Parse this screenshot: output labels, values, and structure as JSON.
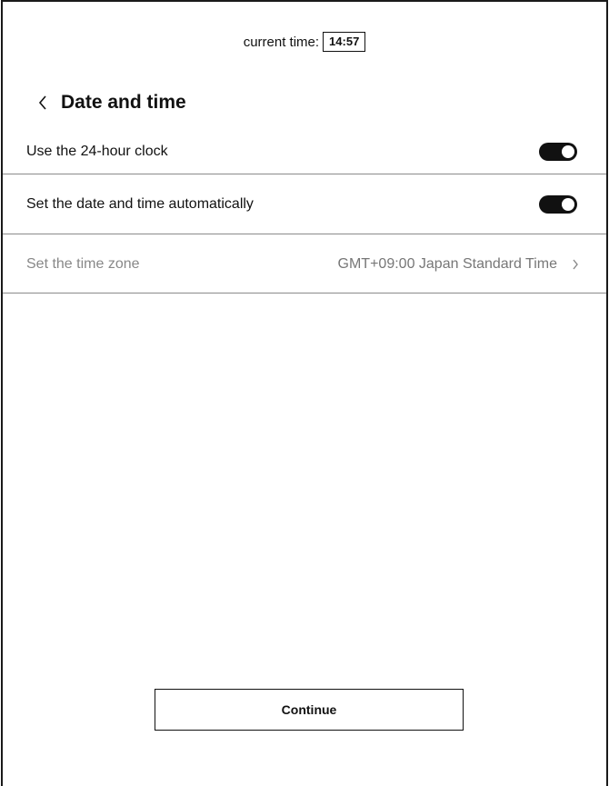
{
  "status_bar": {
    "label": "current time:",
    "time": "14:57"
  },
  "header": {
    "back_icon": "chevron-left-icon",
    "title": "Date and time"
  },
  "settings": {
    "clock_24h": {
      "label": "Use the 24-hour clock",
      "enabled": true
    },
    "auto_datetime": {
      "label": "Set the date and time automatically",
      "enabled": true
    },
    "time_zone": {
      "label": "Set the time zone",
      "value": "GMT+09:00 Japan Standard Time",
      "icon": "chevron-right-icon",
      "disabled": true
    }
  },
  "footer": {
    "continue_label": "Continue"
  },
  "colors": {
    "text": "#111111",
    "muted_text": "#888888",
    "divider": "#8a8a8a",
    "toggle_on": "#111111"
  }
}
